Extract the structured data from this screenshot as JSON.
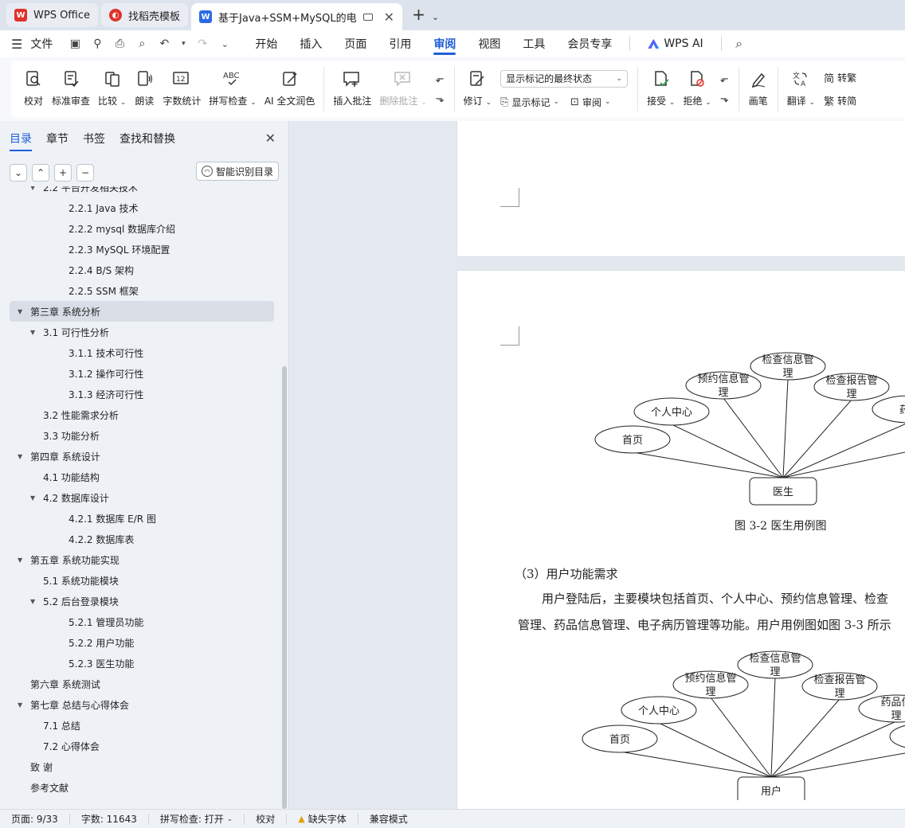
{
  "tabs": [
    {
      "name": "WPS Office",
      "icon": "wps-logo-icon"
    },
    {
      "name": "找稻壳模板",
      "icon": "daoke-logo-icon"
    },
    {
      "name": "基于Java+SSM+MySQL的电",
      "icon": "word-doc-icon"
    }
  ],
  "menu": {
    "file": "文件",
    "items": [
      "开始",
      "插入",
      "页面",
      "引用",
      "审阅",
      "视图",
      "工具",
      "会员专享"
    ],
    "active": "审阅",
    "ai": "WPS AI"
  },
  "ribbon": {
    "proofread": "校对",
    "standard_review": "标准审查",
    "compare": "比较",
    "read_aloud": "朗读",
    "word_count": "字数统计",
    "spell_check": "拼写检查",
    "ai_polish": "AI 全文润色",
    "insert_comment": "插入批注",
    "delete_comment": "删除批注",
    "revise": "修订",
    "markup_select": "显示标记的最终状态",
    "show_markup": "显示标记",
    "review": "审阅",
    "accept": "接受",
    "reject": "拒绝",
    "pen": "画笔",
    "translate": "翻译",
    "to_traditional": "转繁",
    "to_simplified": "转简"
  },
  "nav": {
    "tabs": [
      "目录",
      "章节",
      "书签",
      "查找和替换"
    ],
    "smart_toc": "智能识别目录",
    "toc": [
      {
        "level": 2,
        "text": "2.2  平台开发相关技术",
        "expand": true
      },
      {
        "level": 3,
        "text": "2.2.1   Java 技术"
      },
      {
        "level": 3,
        "text": "2.2.2   mysql 数据库介绍"
      },
      {
        "level": 3,
        "text": "2.2.3   MySQL 环境配置"
      },
      {
        "level": 3,
        "text": "2.2.4   B/S 架构"
      },
      {
        "level": 3,
        "text": "2.2.5   SSM 框架"
      },
      {
        "level": 1,
        "text": "第三章  系统分析",
        "expand": true,
        "selected": true
      },
      {
        "level": 2,
        "text": "3.1  可行性分析",
        "expand": true
      },
      {
        "level": 3,
        "text": "3.1.1 技术可行性"
      },
      {
        "level": 3,
        "text": "3.1.2 操作可行性"
      },
      {
        "level": 3,
        "text": "3.1.3  经济可行性"
      },
      {
        "level": 2,
        "text": "3.2 性能需求分析"
      },
      {
        "level": 2,
        "text": "3.3 功能分析"
      },
      {
        "level": 1,
        "text": "第四章  系统设计",
        "expand": true
      },
      {
        "level": 2,
        "text": "4.1 功能结构"
      },
      {
        "level": 2,
        "text": "4.2  数据库设计",
        "expand": true
      },
      {
        "level": 3,
        "text": "4.2.1  数据库 E/R 图"
      },
      {
        "level": 3,
        "text": "4.2.2  数据库表"
      },
      {
        "level": 1,
        "text": "第五章  系统功能实现",
        "expand": true
      },
      {
        "level": 2,
        "text": "5.1 系统功能模块"
      },
      {
        "level": 2,
        "text": "5.2 后台登录模块",
        "expand": true
      },
      {
        "level": 3,
        "text": "5.2.1 管理员功能"
      },
      {
        "level": 3,
        "text": "5.2.2 用户功能"
      },
      {
        "level": 3,
        "text": "5.2.3 医生功能"
      },
      {
        "level": 1,
        "text": "第六章  系统测试"
      },
      {
        "level": 1,
        "text": "第七章  总结与心得体会",
        "expand": true
      },
      {
        "level": 2,
        "text": "7.1  总结"
      },
      {
        "level": 2,
        "text": "7.2  心得体会"
      },
      {
        "level": 1,
        "text": "致  谢"
      },
      {
        "level": 1,
        "text": "参考文献"
      }
    ]
  },
  "doc": {
    "diagram1": {
      "actor": "医生",
      "nodes": [
        "首页",
        "个人中心",
        "预约信息管\n理",
        "检查信息管\n理",
        "检查报告管\n理",
        "药品"
      ],
      "caption": "图 3-2 医生用例图"
    },
    "section_heading": "（3）用户功能需求",
    "para_line1": "用户登陆后，主要模块包括首页、个人中心、预约信息管理、检查",
    "para_line2": "管理、药品信息管理、电子病历管理等功能。用户用例图如图 3-3 所示",
    "diagram2": {
      "actor": "用户",
      "nodes": [
        "首页",
        "个人中心",
        "预约信息管\n理",
        "检查信息管\n理",
        "检查报告管\n理",
        "药品信\n理",
        "电"
      ]
    }
  },
  "status": {
    "page": "页面: 9/33",
    "words": "字数: 11643",
    "spell": "拼写检查: 打开",
    "proof": "校对",
    "missing_font": "缺失字体",
    "compat": "兼容模式"
  }
}
